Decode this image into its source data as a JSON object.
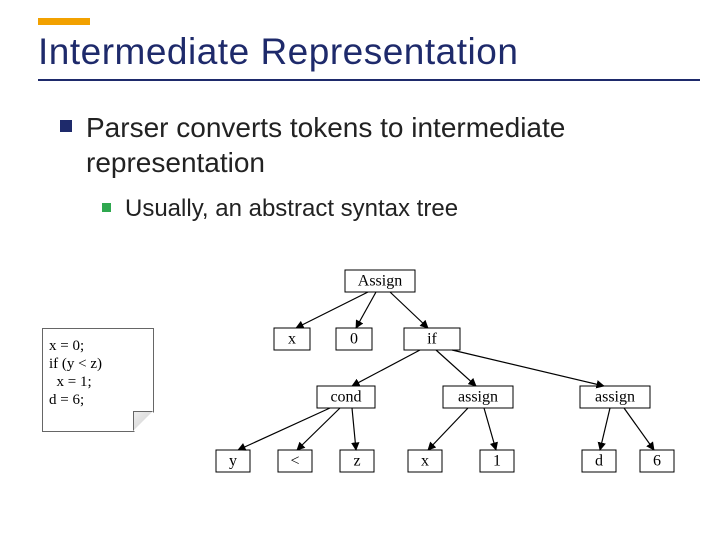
{
  "title": "Intermediate Representation",
  "bullet1": "Parser converts tokens to intermediate representation",
  "bullet1a": "Usually, an abstract syntax tree",
  "code": {
    "l1": "x = 0;",
    "l2": "if (y < z)",
    "l3": "  x = 1;",
    "l4": "d = 6;"
  },
  "tree": {
    "root": "Assign",
    "n_x": "x",
    "n_0": "0",
    "n_if": "if",
    "n_cond": "cond",
    "n_assign1": "assign",
    "n_assign2": "assign",
    "n_y": "y",
    "n_lt": "<",
    "n_z": "z",
    "n_x2": "x",
    "n_1": "1",
    "n_d": "d",
    "n_6": "6"
  }
}
